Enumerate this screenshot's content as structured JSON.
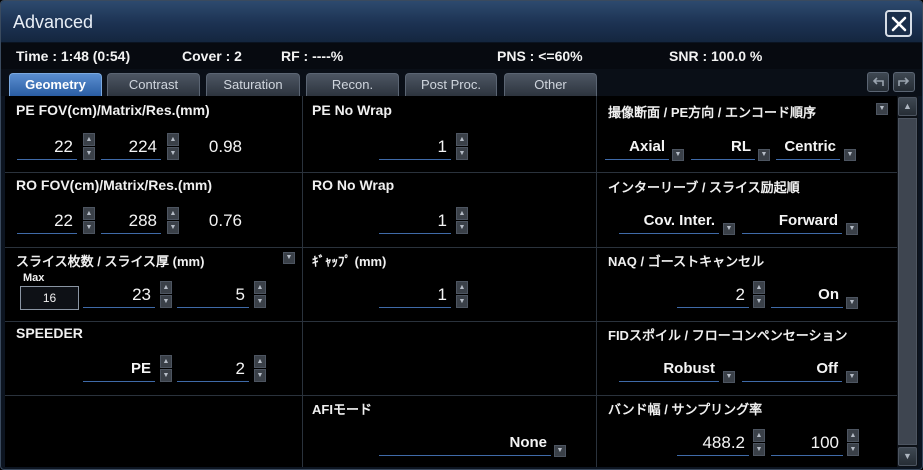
{
  "window": {
    "title": "Advanced"
  },
  "status": {
    "time": "Time : 1:48 (0:54)",
    "cover": "Cover : 2",
    "rf": "RF : ----%",
    "pns": "PNS : <=60%",
    "snr": "SNR :  100.0 %"
  },
  "tabs": [
    "Geometry",
    "Contrast",
    "Saturation",
    "Recon.",
    "Post Proc.",
    "Other"
  ],
  "active_tab": "Geometry",
  "params": {
    "pe_fov": {
      "title": "PE FOV(cm)/Matrix/Res.(mm)",
      "fov": "22",
      "matrix": "224",
      "res": "0.98"
    },
    "ro_fov": {
      "title": "RO FOV(cm)/Matrix/Res.(mm)",
      "fov": "22",
      "matrix": "288",
      "res": "0.76"
    },
    "slices": {
      "title": "スライス枚数 / スライス厚 (mm)",
      "max_label": "Max",
      "max": "16",
      "count": "23",
      "thickness": "5"
    },
    "speeder": {
      "title": "SPEEDER",
      "direction": "PE",
      "factor": "2"
    },
    "pe_nowrap": {
      "title": "PE No Wrap",
      "value": "1"
    },
    "ro_nowrap": {
      "title": "RO No Wrap",
      "value": "1"
    },
    "gap": {
      "title": "ｷﾞｬｯﾌﾟ (mm)",
      "value": "1"
    },
    "afi": {
      "title": "AFIモード",
      "value": "None"
    },
    "plane": {
      "title": "撮像断面 / PE方向 / エンコード順序",
      "plane": "Axial",
      "pe_dir": "RL",
      "order": "Centric"
    },
    "interleave": {
      "title": "インターリーブ / スライス励起順",
      "inter": "Cov. Inter.",
      "order": "Forward"
    },
    "naq": {
      "title": "NAQ / ゴーストキャンセル",
      "naq": "2",
      "ghost": "On"
    },
    "fid": {
      "title": "FIDスポイル / フローコンペンセーション",
      "spoil": "Robust",
      "flow": "Off"
    },
    "bandwidth": {
      "title": "バンド幅 / サンプリング率",
      "bw": "488.2",
      "rate": "100"
    }
  },
  "icons": {
    "close": "close-icon",
    "undo": "undo-icon",
    "redo": "redo-icon"
  },
  "colors": {
    "accent": "#3f6aa8",
    "title_bar": "#1c3252",
    "active_tab": "#3a6fb8"
  }
}
